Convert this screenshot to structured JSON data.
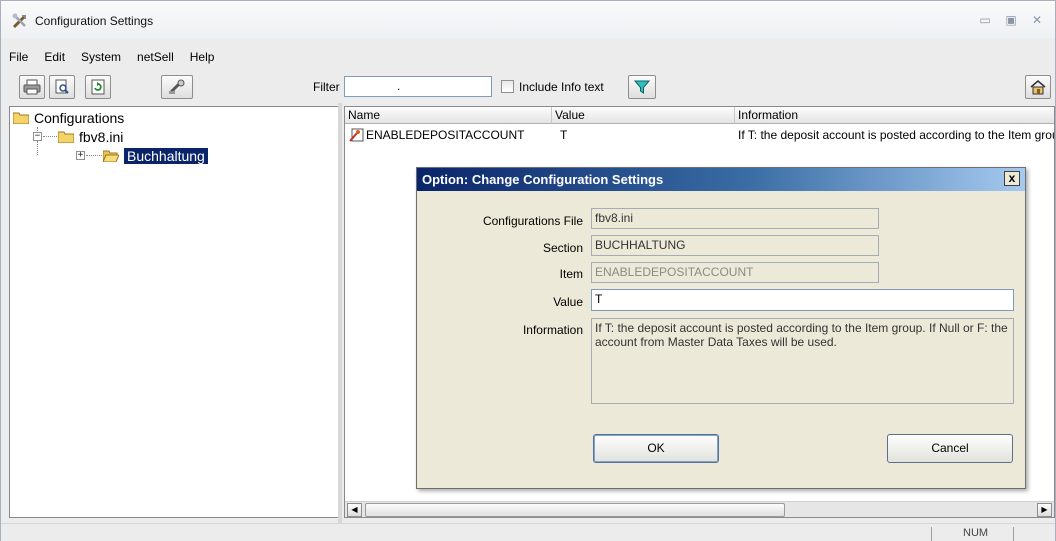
{
  "window": {
    "title": "Configuration Settings"
  },
  "menu": [
    "File",
    "Edit",
    "System",
    "netSell",
    "Help"
  ],
  "toolbar": {
    "filter_label": "Filter",
    "filter_value": ".",
    "include_info_label": "Include Info text"
  },
  "tree": {
    "root": "Configurations",
    "file": "fbv8.ini",
    "section": "Buchhaltung"
  },
  "list": {
    "columns": [
      "Name",
      "Value",
      "Information"
    ],
    "rows": [
      {
        "name": "ENABLEDEPOSITACCOUNT",
        "value": "T",
        "information": "If T: the deposit account is posted according to the Item group. If Null or F: the account from Master Data Taxes will be used."
      }
    ]
  },
  "dialog": {
    "title": "Option: Change Configuration Settings",
    "close_label": "x",
    "fields": {
      "configurations_file": {
        "label": "Configurations File",
        "value": "fbv8.ini"
      },
      "section": {
        "label": "Section",
        "value": "BUCHHALTUNG"
      },
      "item": {
        "label": "Item",
        "value": "ENABLEDEPOSITACCOUNT"
      },
      "value": {
        "label": "Value",
        "value": "T"
      },
      "information": {
        "label": "Information",
        "value": "If T: the deposit account is posted according to the Item group. If Null or F: the account from Master Data Taxes will be used."
      }
    },
    "ok_label": "OK",
    "cancel_label": "Cancel"
  },
  "status": {
    "num": "NUM"
  }
}
